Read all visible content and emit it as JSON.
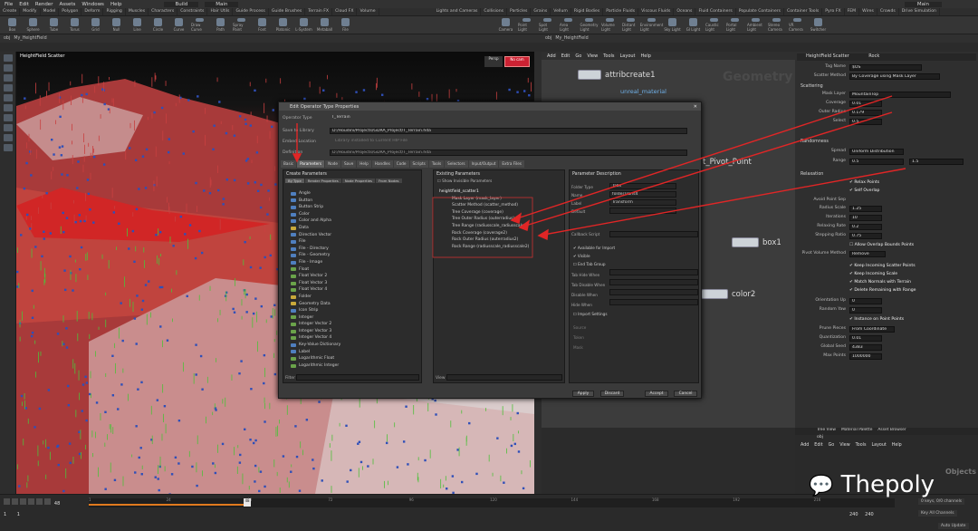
{
  "menubar": {
    "items": [
      "File",
      "Edit",
      "Render",
      "Assets",
      "Windows",
      "Help"
    ],
    "build": "Build",
    "main": "Main",
    "user": "Main"
  },
  "shelf_tabs": [
    "Create",
    "Modify",
    "Model",
    "Polygon",
    "Deform",
    "Rigging",
    "Muscles",
    "Characters",
    "Constraints",
    "Hair Utils",
    "Guide Process",
    "Guide Brushes",
    "Terrain FX",
    "Cloud FX",
    "Volume"
  ],
  "shelf_tools": [
    "Box",
    "Sphere",
    "Tube",
    "Torus",
    "Grid",
    "Null",
    "Line",
    "Circle",
    "Curve",
    "Draw Curve",
    "Path",
    "Spray Paint",
    "Font",
    "Platonic",
    "L-System",
    "Metaball",
    "File"
  ],
  "lights_tabs": [
    "Lights and Cameras",
    "Collisions",
    "Particles",
    "Grains",
    "Vellum",
    "Rigid Bodies",
    "Particle Fluids",
    "Viscous Fluids",
    "Oceans",
    "Fluid Containers",
    "Populate Containers",
    "Container Tools",
    "Pyro FX",
    "FEM",
    "Wires",
    "Crowds",
    "Drive Simulation"
  ],
  "lights_tools": [
    "Camera",
    "Point Light",
    "Spot Light",
    "Area Light",
    "Geometry Light",
    "Volume Light",
    "Distant Light",
    "Environment Light",
    "Sky Light",
    "GI Light",
    "Caustic Light",
    "Portal Light",
    "Ambient Light",
    "Stereo Camera",
    "VR Camera",
    "Switcher"
  ],
  "viewport": {
    "path_obj": "obj",
    "path_node": "My_HeightField",
    "tab_label": "Scene View",
    "pane_label": "HeightField Scatter",
    "view_mode": "Persp",
    "cam": "No cam"
  },
  "network": {
    "path_obj": "obj",
    "path_node": "My_HeightField",
    "menu": [
      "Add",
      "Edit",
      "Go",
      "View",
      "Tools",
      "Layout",
      "Help"
    ],
    "context_label": "Geometry"
  },
  "nodes": [
    {
      "title": "attribcreate1",
      "subtitle": "unreal_material"
    },
    {
      "title": "t_Pivot_Point"
    },
    {
      "title": "box1"
    },
    {
      "title": "color2"
    }
  ],
  "params": {
    "header_type": "HeightField Scatter",
    "header_name": "Rock",
    "group_name_label": "Tag Name",
    "group_name_val": "$OS",
    "scatter_method_label": "Scatter Method",
    "scatter_method_val": "By Coverage using Mask Layer",
    "scattering_section": "Scattering",
    "mask_layer_label": "Mask Layer",
    "mask_layer_val": "MountainTop",
    "coverage_label": "Coverage",
    "coverage_val": "0.01",
    "outer_radius_label": "Outer Radius",
    "outer_radius_val": "0.179",
    "select_label": "Select",
    "select_val": "0.5",
    "randomness_section": "Randomness",
    "spread_label": "Spread",
    "spread_val": "Uniform Distribution",
    "range_label": "Range",
    "range_min": "0.5",
    "range_max": "1.5",
    "relaxation_section": "Relaxation",
    "relax_points": "Relax Points",
    "self_overlap": "Self Overlap",
    "avoid_label": "Avoid Point Sep",
    "radius_scale_label": "Radius Scale",
    "radius_scale_val": "1.25",
    "iterations_label": "Iterations",
    "iterations_val": "10",
    "relax_step_label": "Relaxing Rate",
    "relax_step_val": "0.2",
    "stepping_label": "Stepping Ratio",
    "stepping_val": "0.75",
    "allow_overlap": "Allow Overlap Bounds Points",
    "pivot_label": "Pivot Volume Method",
    "pivot_val": "Remove",
    "opt1": "Keep Incoming Scatter Points",
    "opt2": "Keep Incoming Scale",
    "opt3": "Match Normals with Terrain",
    "opt4": "Delete Remaining with Range",
    "orient_label": "Orientation Up",
    "orient_val": "0",
    "random_rot_label": "Random Yaw",
    "random_rot_val": "0",
    "instance_label": "Instance on Point Points",
    "prune_label": "Prune Pieces",
    "prune_val": "From Coordinate",
    "quantization_label": "Quantization",
    "quantization_val": "0.01",
    "global_seed_label": "Global Seed",
    "global_seed_val": "4383",
    "max_points_label": "Max Points",
    "max_points_val": "1000000"
  },
  "bottompane": {
    "tabs": [
      "Tree View",
      "Material Palette",
      "Asset Browser"
    ],
    "path_obj": "obj",
    "menu": [
      "Add",
      "Edit",
      "Go",
      "View",
      "Tools",
      "Layout",
      "Help"
    ],
    "watermark": "Objects"
  },
  "timeline": {
    "frame": "48",
    "end1": "240",
    "end2": "240",
    "start1": "1",
    "start2": "1",
    "keys_label": "0 keys, 0/0 channels",
    "key_all": "Key All Channels",
    "auto_update": "Auto Update",
    "ticks": [
      "1",
      "24",
      "48",
      "72",
      "96",
      "120",
      "144",
      "168",
      "192",
      "216"
    ]
  },
  "dialog": {
    "title": "Edit Operator Type Properties",
    "operator_type_label": "Operator Type",
    "operator_type_val": "T_Terrain",
    "save_library_label": "Save to Library",
    "save_library_val": "D:/Houdini/Projects/GDRA_Project/T_Terrain.hda",
    "embedded_label": "Embed Location",
    "embedded_val": "Library installed to Current HIP File",
    "definition_label": "Definition",
    "definition_val": "D:/Houdini/Projects/GDRA_Project/T_Terrain.hda",
    "tabs": [
      "Basic",
      "Parameters",
      "Node",
      "Save",
      "Help",
      "Handles",
      "Code",
      "Scripts",
      "Tools",
      "Selectors",
      "Input/Output",
      "Extra Files"
    ],
    "create_title": "Create Parameters",
    "create_subtabs": [
      "By Type",
      "Render Properties",
      "Node Properties",
      "From Nodes"
    ],
    "create_list": [
      {
        "label": "Angle",
        "c": "b"
      },
      {
        "label": "Button",
        "c": "b"
      },
      {
        "label": "Button Strip",
        "c": "b"
      },
      {
        "label": "Color",
        "c": "b"
      },
      {
        "label": "Color and Alpha",
        "c": "b"
      },
      {
        "label": "Data",
        "c": "y"
      },
      {
        "label": "Direction Vector",
        "c": "b"
      },
      {
        "label": "File",
        "c": "b"
      },
      {
        "label": "File - Directory",
        "c": "b"
      },
      {
        "label": "File - Geometry",
        "c": "b"
      },
      {
        "label": "File - Image",
        "c": "b"
      },
      {
        "label": "Float",
        "c": "g"
      },
      {
        "label": "Float Vector 2",
        "c": "g"
      },
      {
        "label": "Float Vector 3",
        "c": "g"
      },
      {
        "label": "Float Vector 4",
        "c": "g"
      },
      {
        "label": "Folder",
        "c": "y"
      },
      {
        "label": "Geometry Data",
        "c": "y"
      },
      {
        "label": "Icon Strip",
        "c": "b"
      },
      {
        "label": "Integer",
        "c": "g"
      },
      {
        "label": "Integer Vector 2",
        "c": "g"
      },
      {
        "label": "Integer Vector 3",
        "c": "g"
      },
      {
        "label": "Integer Vector 4",
        "c": "g"
      },
      {
        "label": "Key-Value Dictionary",
        "c": "b"
      },
      {
        "label": "Label",
        "c": "b"
      },
      {
        "label": "Logarithmic Float",
        "c": "g"
      },
      {
        "label": "Logarithmic Integer",
        "c": "g"
      }
    ],
    "filter_label": "Filter",
    "existing_title": "Existing Parameters",
    "existing_check": "Show Invisible Parameters",
    "root_item": "heightfield_scatter1",
    "existing_list": [
      "Mask Layer (mask_layer)",
      "Scatter Method (scatter_method)",
      "Tree Coverage (coverage)",
      "Tree Outer Radius (outerradius)",
      "Tree Range (radiusscale_radiusscale)",
      "Rock Coverage (coverage2)",
      "Rock Outer Radius (outerradius2)",
      "Rock Range (radiusscale_radiusscale2)"
    ],
    "view_label": "View",
    "desc_title": "Parameter Description",
    "desc_fields": [
      "Folder Type",
      "Name",
      "Label",
      "Default",
      "Callback Script",
      "Tab Hide When",
      "Tab Disable When",
      "Disable When",
      "Hide When",
      "Import Settings",
      "Source",
      "Token",
      "Mask"
    ],
    "folder_type_val": "Tabs",
    "name_val": "folderTrans4",
    "label_val": "Transform",
    "desc_checks": [
      "Available for Import",
      "Visible",
      "End Tab Group"
    ],
    "buttons": [
      "Apply",
      "Discard",
      "Accept",
      "Cancel"
    ]
  },
  "logo": "Thepoly",
  "colors": {
    "accent_red": "#e02626",
    "node_blue": "#6fb0e8",
    "play_orange": "#e07a1e"
  }
}
